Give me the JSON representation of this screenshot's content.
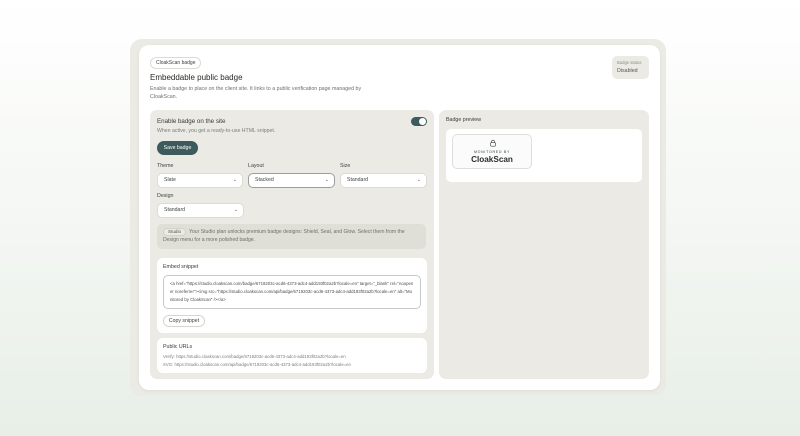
{
  "header": {
    "pill": "CloakScan badge",
    "title": "Embeddable public badge",
    "description": "Enable a badge to place on the client site. It links to a public verification page managed by CloakScan."
  },
  "status": {
    "label": "Badge status",
    "value": "Disabled"
  },
  "enable": {
    "title": "Enable badge on the site",
    "description": "When active, you get a ready-to-use HTML snippet.",
    "toggle_on": true,
    "save_label": "Save badge"
  },
  "fields": {
    "theme": {
      "label": "Theme",
      "value": "Slate"
    },
    "layout": {
      "label": "Layout",
      "value": "Stacked"
    },
    "size": {
      "label": "Size",
      "value": "Standard"
    },
    "design": {
      "label": "Design",
      "value": "Standard"
    }
  },
  "info": {
    "tag": "Studio",
    "text": "Your Studio plan unlocks premium badge designs: Shield, Seal, and Glow. Select them from the Design menu for a more polished badge."
  },
  "snippet": {
    "title": "Embed snippet",
    "code": "<a href=\"https://studio.cloakscan.com/badge/6719203c-acd6-4373-adc4-add193f02a2b?locale=en\" target=\"_blank\" rel=\"noopener noreferrer\"><img src=\"https://studio.cloakscan.com/api/badge/6719203c-acd6-4373-adc4-add193f02a2b?locale=en\" alt=\"Monitored by CloakScan\" /></a>",
    "copy_label": "Copy snippet"
  },
  "urls": {
    "title": "Public URLs",
    "verify": "Verify: https://studio.cloakscan.com/badge/6719203c-acd6-4373-adc4-add193f02a2b?locale=en",
    "svg": "SVG: https://studio.cloakscan.com/api/badge/6719203c-acd6-4373-adc4-add193f02a2b?locale=en"
  },
  "preview": {
    "title": "Badge preview",
    "badge_top": "MONITORED BY",
    "badge_brand": "CloakScan",
    "icon": "lock-icon"
  },
  "colors": {
    "accent": "#3d5a5c",
    "panel": "#ebeae4",
    "card": "#ffffff"
  }
}
